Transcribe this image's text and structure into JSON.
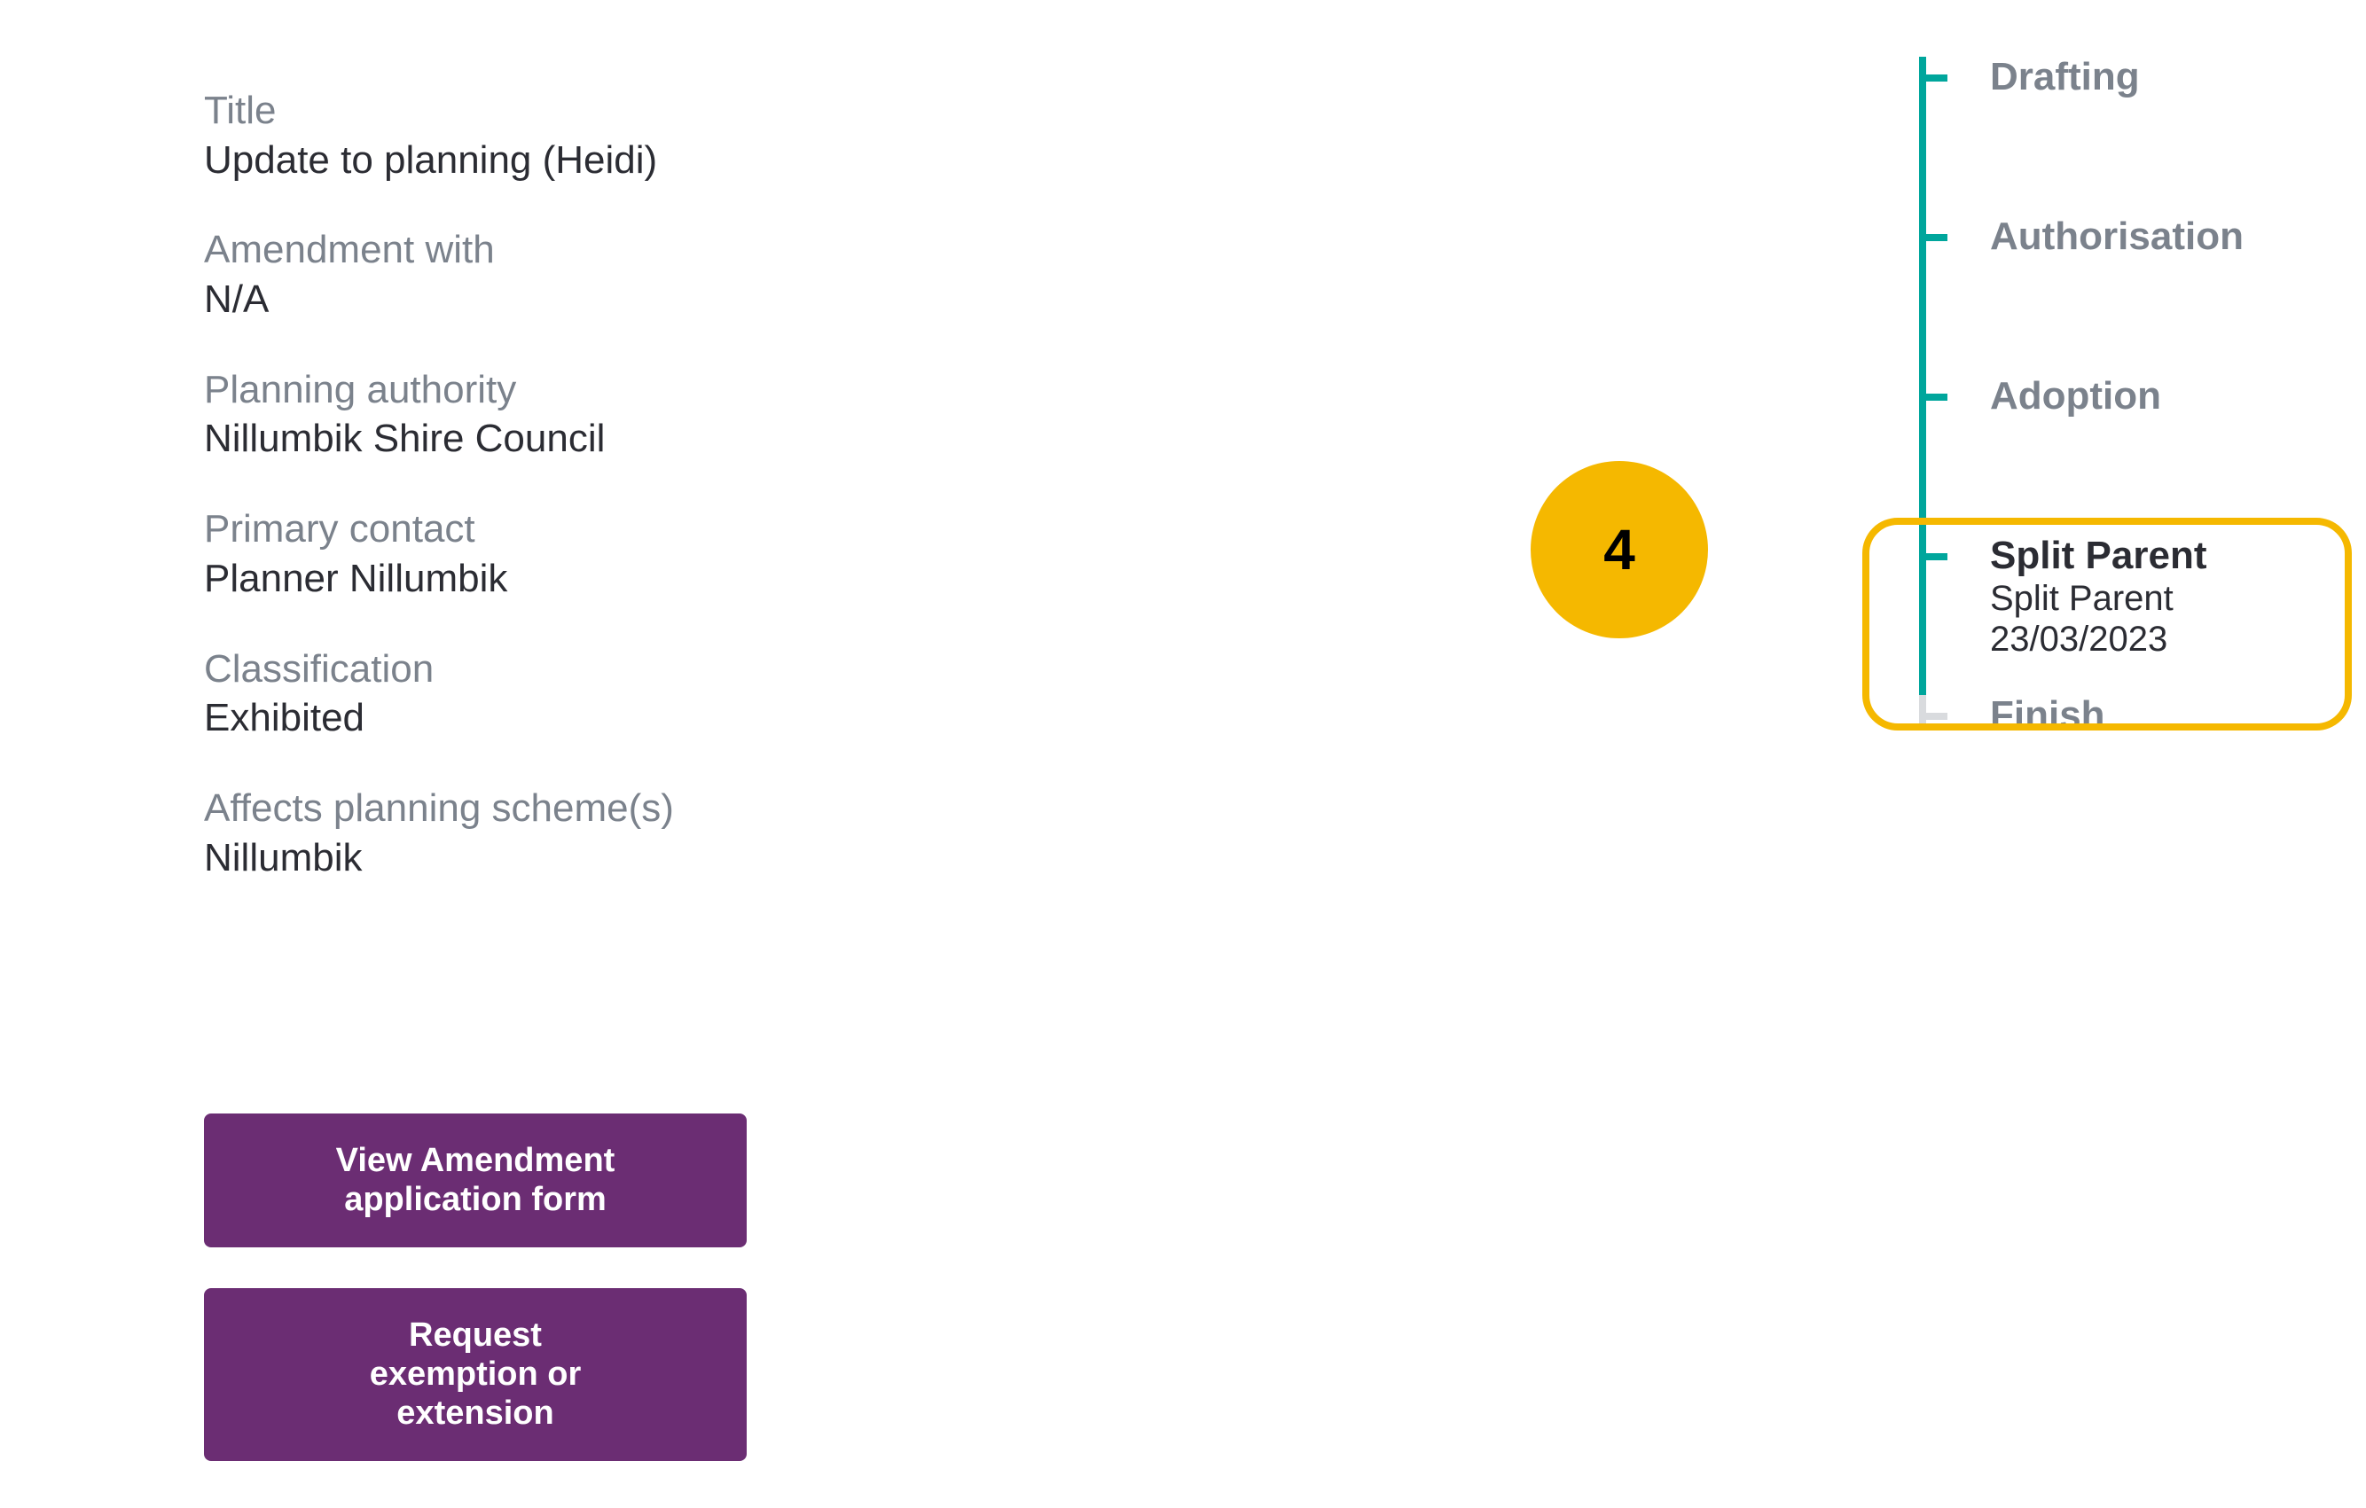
{
  "details": {
    "title_label": "Title",
    "title_value": "Update to planning (Heidi)",
    "amendment_with_label": "Amendment with",
    "amendment_with_value": "N/A",
    "planning_authority_label": "Planning authority",
    "planning_authority_value": "Nillumbik Shire Council",
    "primary_contact_label": "Primary contact",
    "primary_contact_value": "Planner Nillumbik",
    "classification_label": "Classification",
    "classification_value": "Exhibited",
    "affects_schemes_label": "Affects planning scheme(s)",
    "affects_schemes_value": "Nillumbik"
  },
  "buttons": {
    "view_form": "View Amendment\napplication form",
    "request_ext": "Request\nexemption or\nextension"
  },
  "timeline": {
    "drafting": "Drafting",
    "authorisation": "Authorisation",
    "adoption": "Adoption",
    "split_parent_title": "Split Parent",
    "split_parent_sub1": "Split Parent",
    "split_parent_sub2": "23/03/2023",
    "finish": "Finish"
  },
  "annotation": {
    "badge_number": "4"
  }
}
